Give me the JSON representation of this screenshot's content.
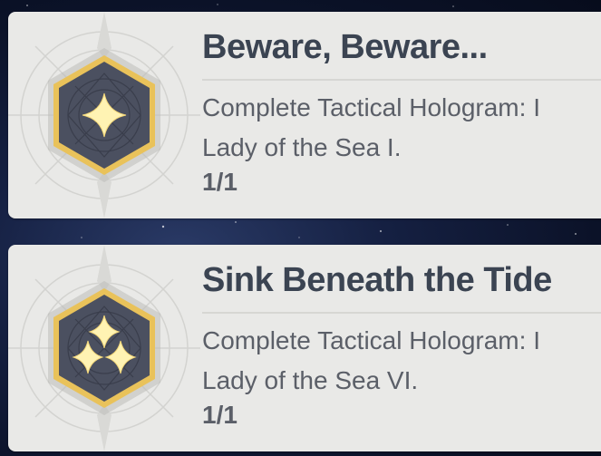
{
  "achievements": [
    {
      "title": "Beware, Beware...",
      "description_line1": "Complete Tactical Hologram: I",
      "description_line2": "Lady of the Sea I.",
      "progress": "1/1",
      "star_count": 1
    },
    {
      "title": "Sink Beneath the Tide",
      "description_line1": "Complete Tactical Hologram: I",
      "description_line2": "Lady of the Sea VI.",
      "progress": "1/1",
      "star_count": 3
    }
  ],
  "colors": {
    "card_bg": "#e9e9e7",
    "title_text": "#3b4452",
    "body_text": "#5b5f68",
    "badge_gold": "#e9c25a",
    "badge_core": "#4b5060",
    "star_fill": "#fff3b3"
  }
}
